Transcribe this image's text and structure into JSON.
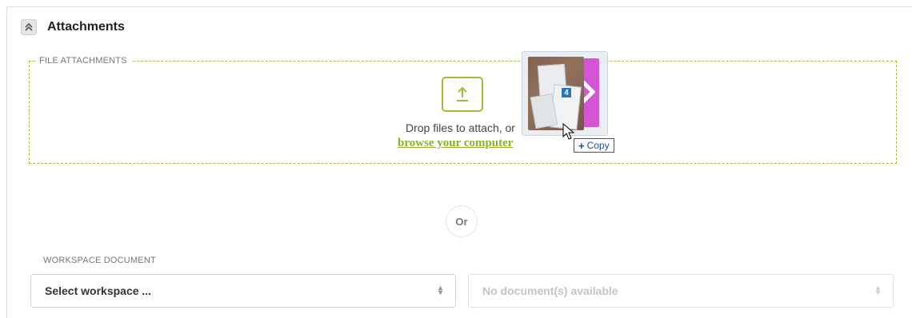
{
  "section": {
    "title": "Attachments",
    "collapse_icon": "chevron-double-up-icon"
  },
  "file_attachments": {
    "legend": "FILE ATTACHMENTS",
    "upload_icon": "upload-icon",
    "drop_text": "Drop files to attach, or",
    "browse_link": "browse your computer",
    "accent_color": "#9bbf3a"
  },
  "drag_ghost": {
    "file_count": "4",
    "copy_label": "Copy",
    "copy_prefix": "+"
  },
  "divider": {
    "or_label": "Or"
  },
  "workspace_document": {
    "label": "WORKSPACE DOCUMENT",
    "workspace_select": {
      "value": "Select workspace ..."
    },
    "document_select": {
      "value": "No document(s) available",
      "disabled": true
    }
  }
}
